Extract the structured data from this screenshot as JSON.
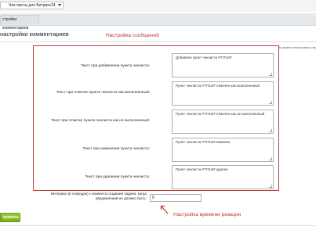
{
  "header": {
    "module_select_value": "Чек-листы для Битрикс24",
    "tab_label": "стройки комментариев"
  },
  "page": {
    "section_title": "настройки комментариев",
    "right_note": "Вы можете использовать следующие пе"
  },
  "annotations": {
    "messages": "Настройка сообщений",
    "reaction_time": "Настройка времени реакции"
  },
  "fields": [
    {
      "label": "Текст при добавлении пункта чеклиста:",
      "value": "Добавлен пункт чеклиста #TITLE#"
    },
    {
      "label": "Текст при отметке пункта чеклиста как выполненный:",
      "value": "Пункт чеклиста #TITLE# отмечен как выполненный"
    },
    {
      "label": "Текст при отметке пункта чеклиста как не выполненный:",
      "value": "Пункт чеклиста #TITLE# отмечен как не выполненный"
    },
    {
      "label": "Текст при изменении пункта чеклиста:",
      "value": "Пункт чеклиста #TITLE# изменён"
    },
    {
      "label": "Текст при удалении пункта чеклиста:",
      "value": "Пункт чеклиста #TITLE# удален"
    }
  ],
  "interval": {
    "label": "Интервал (в секундах) с момента создания задачи, когда уведомлений не должно быть:",
    "value": "0"
  },
  "buttons": {
    "save_label": "хранить"
  },
  "colors": {
    "annotation_red": "#c0392b",
    "save_green": "#86bd28"
  }
}
